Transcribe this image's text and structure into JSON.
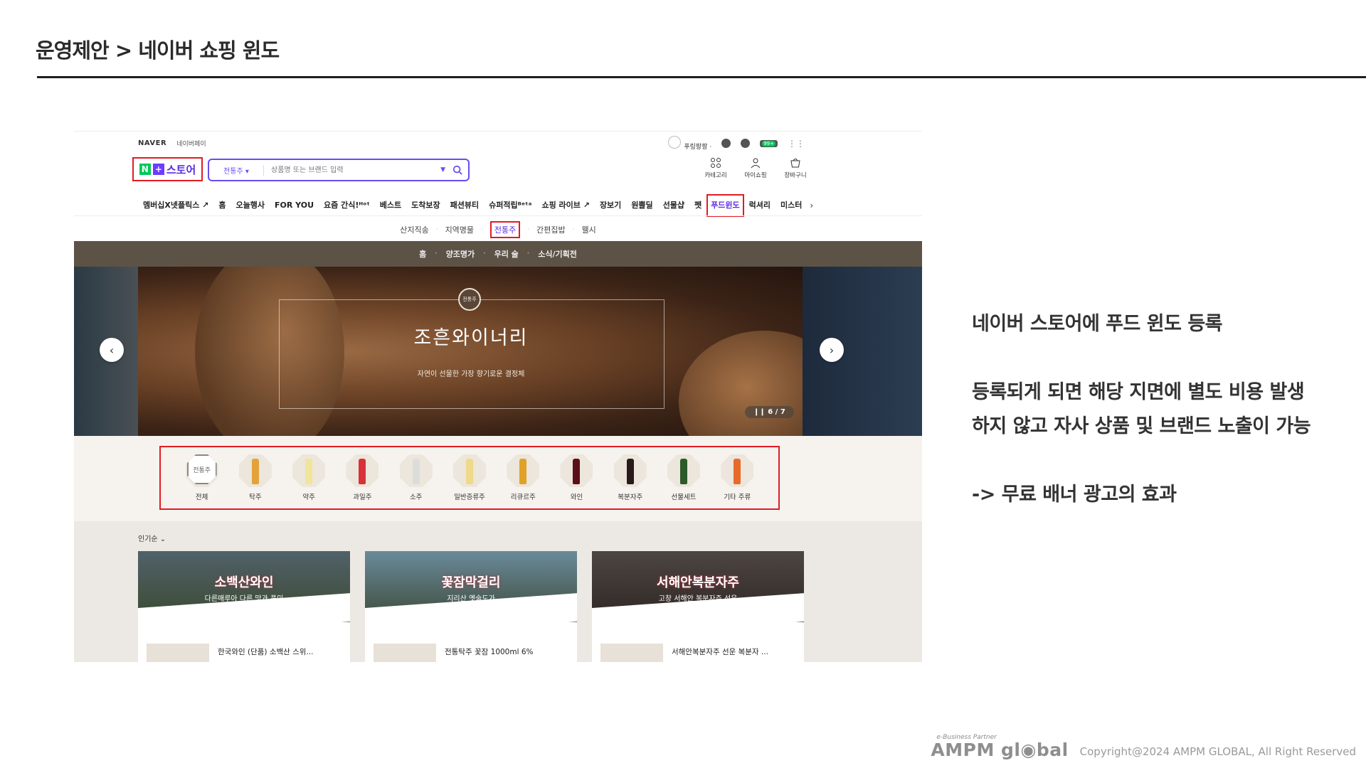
{
  "slide": {
    "title": "운영제안 > 네이버 쇼핑 윈도"
  },
  "screenshot": {
    "topbar": {
      "naver": "NAVER",
      "pay": "네이버페이"
    },
    "util": {
      "user": "푸링팡팡 ·",
      "badge": "99+"
    },
    "logo": {
      "n": "N",
      "plus": "+",
      "text": "스토어"
    },
    "search": {
      "category": "전통주 ▾",
      "placeholder": "상품명 또는 브랜드 입력",
      "dropdown": "▼"
    },
    "shortcuts": [
      {
        "label": "카테고리",
        "icon": "grid-icon"
      },
      {
        "label": "마이쇼핑",
        "icon": "person-icon"
      },
      {
        "label": "장바구니",
        "icon": "cart-icon"
      }
    ],
    "gnb": [
      "멤버십X넷플릭스 ↗",
      "홈",
      "오늘행사",
      "FOR YOU",
      "요즘 간식!ᴴᵒᵗ",
      "베스트",
      "도착보장",
      "패션뷰티",
      "슈퍼적립ᴮᵉᵗᵃ",
      "쇼핑 라이브 ↗",
      "장보기",
      "원쁠딜",
      "선물샵",
      "펫",
      "푸드윈도",
      "럭셔리",
      "미스터"
    ],
    "gnb_highlight_index": 14,
    "gnb_more": "›",
    "subcats": [
      "산지직송",
      "지역명물",
      "전통주",
      "간편집밥",
      "웰시"
    ],
    "subcat_highlight_index": 2,
    "catbar": [
      "홈",
      "양조명가",
      "우리 술",
      "소식/기획전"
    ],
    "banner": {
      "emblem": "전통주",
      "title": "조흔와이너리",
      "subtitle": "자연이 선물한 가장 향기로운 결정체",
      "pager": "❙❙  6 / 7",
      "prev": "‹",
      "next": "›"
    },
    "categories": [
      {
        "label": "전체",
        "color": ""
      },
      {
        "label": "탁주",
        "color": "#e3a23a"
      },
      {
        "label": "약주",
        "color": "#f1e59a"
      },
      {
        "label": "과일주",
        "color": "#d8313a"
      },
      {
        "label": "소주",
        "color": "#dcdcdc"
      },
      {
        "label": "일반증류주",
        "color": "#efd98a"
      },
      {
        "label": "리큐르주",
        "color": "#e0a128"
      },
      {
        "label": "와인",
        "color": "#5a1018"
      },
      {
        "label": "복분자주",
        "color": "#2a1a1a"
      },
      {
        "label": "선물세트",
        "color": "#2d5a2a"
      },
      {
        "label": "기타 주류",
        "color": "#e76a2a"
      }
    ],
    "categories_stamp": "전통주",
    "sort": "인기순 ⌄",
    "products": [
      {
        "title": "소백산와인",
        "subtitle": "다른매루아 다른 맛과 풍미",
        "name": "한국와인 (단품) 소백산 스위...",
        "sky": "#51616a",
        "ground": "#3a4a30"
      },
      {
        "title": "꽃잠막걸리",
        "subtitle": "지리산 옛술도가",
        "name": "전통탁주 꽃잠 1000ml 6%",
        "sky": "#6a8a9a",
        "ground": "#3d4b3a"
      },
      {
        "title": "서해안복분자주",
        "subtitle": "고창 서해안 복분자주 선운",
        "name": "서해안복분자주 선운 복분자 ...",
        "sky": "#4d4542",
        "ground": "#2e2724"
      }
    ]
  },
  "description": {
    "line1": "네이버 스토어에 푸드 윈도 등록",
    "line2": "등록되게 되면 해당 지면에 별도 비용 발생",
    "line3": "하지 않고 자사 상품 및 브랜드 노출이 가능",
    "line4": "-> 무료 배너 광고의 효과"
  },
  "footer": {
    "tagline": "e-Business Partner",
    "brand": "AMPM gl◉bal",
    "copyright": "Copyright@2024 AMPM GLOBAL, All Right Reserved"
  }
}
